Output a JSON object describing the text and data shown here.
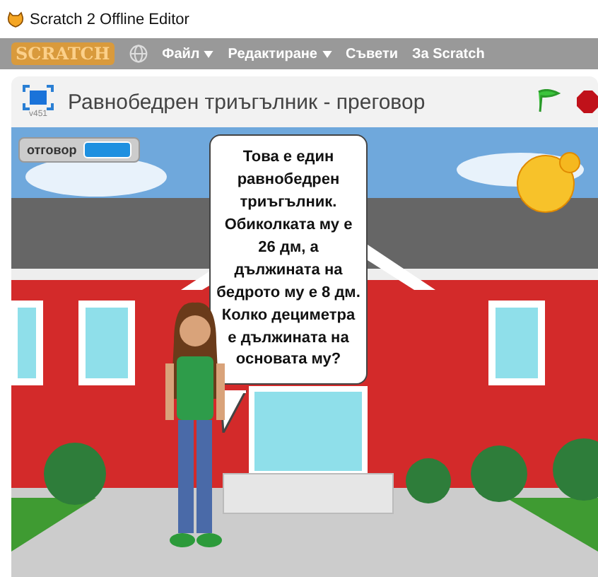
{
  "window": {
    "title": "Scratch 2 Offline Editor"
  },
  "menu": {
    "logo": "SCRATCH",
    "items": [
      {
        "label": "Файл",
        "dropdown": true
      },
      {
        "label": "Редактиране",
        "dropdown": true
      },
      {
        "label": "Съвети",
        "dropdown": false
      },
      {
        "label": "За Scratch",
        "dropdown": false
      }
    ]
  },
  "stage_header": {
    "version": "v451",
    "project_title": "Равнобедрен триъгълник - преговор"
  },
  "stage": {
    "monitor": {
      "label": "отговор"
    },
    "speech_bubble": "Това е един равнобедрен триъгълник. Обиколката му е 26 дм, а дължината на бедрото му е 8 дм. Колко дециметра е дължината на основата му?"
  }
}
